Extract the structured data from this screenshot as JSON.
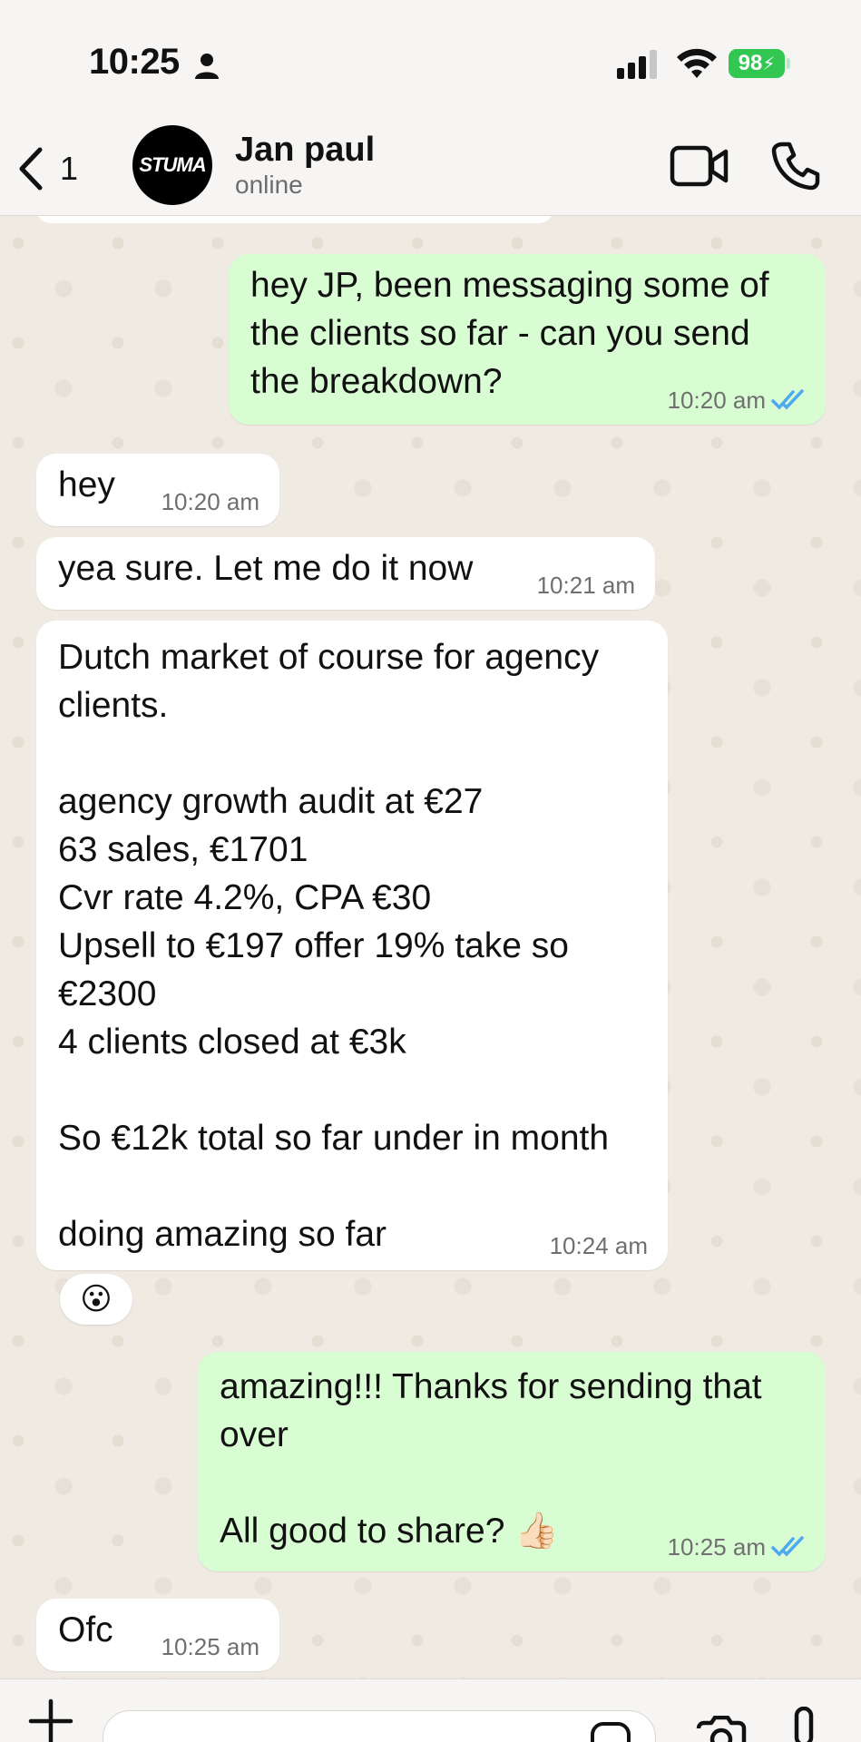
{
  "status_bar": {
    "time": "10:25",
    "battery": "98"
  },
  "header": {
    "back_count": "1",
    "avatar_text": "STUMA",
    "contact_name": "Jan paul",
    "contact_status": "online"
  },
  "messages": [
    {
      "direction": "out",
      "text": "hey JP, been messaging some of\nthe clients so far - can you send\nthe breakdown?",
      "time": "10:20 am",
      "read": true
    },
    {
      "direction": "in",
      "text": "hey",
      "time": "10:20 am"
    },
    {
      "direction": "in",
      "text": "yea sure. Let me do it now",
      "time": "10:21 am"
    },
    {
      "direction": "in",
      "text": "Dutch market of course for agency\nclients.\n\nagency growth audit at €27\n63 sales, €1701\nCvr rate 4.2%, CPA €30\nUpsell to €197 offer 19% take so\n€2300\n4 clients closed at €3k\n\nSo €12k total so far under in month\n\ndoing amazing so far",
      "time": "10:24 am",
      "reaction": "😮"
    },
    {
      "direction": "out",
      "text": "amazing!!! Thanks for sending that\nover\n\nAll good to share? 👍🏻",
      "time": "10:25 am",
      "read": true
    },
    {
      "direction": "in",
      "text": "Ofc",
      "time": "10:25 am"
    }
  ],
  "colors": {
    "outgoing_bubble": "#d9fdd3",
    "incoming_bubble": "#ffffff",
    "read_tick": "#4fa8f0",
    "battery": "#31c751"
  },
  "icons": [
    "person-icon",
    "signal-icon",
    "wifi-icon",
    "back-chevron-icon",
    "video-call-icon",
    "phone-icon",
    "double-check-icon",
    "plus-icon",
    "sticker-icon",
    "camera-icon",
    "mic-icon"
  ]
}
